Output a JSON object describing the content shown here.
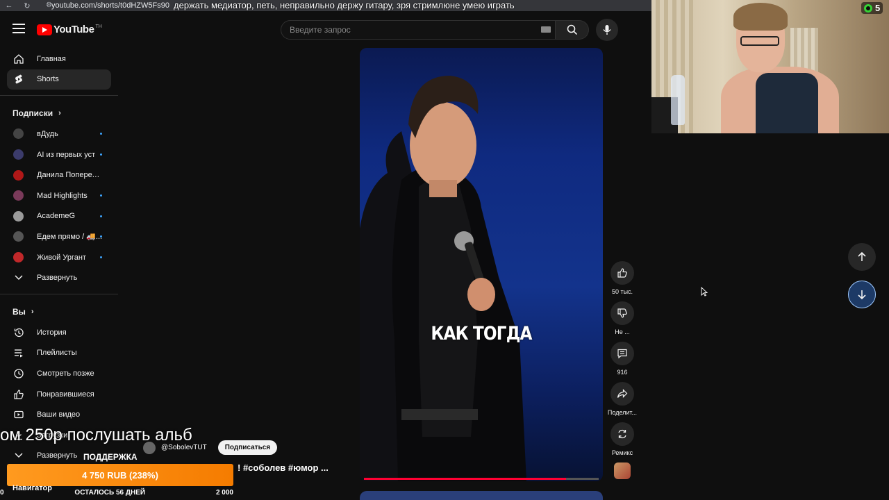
{
  "browser": {
    "url": "youtube.com/shorts/t0dHZW5Fs90"
  },
  "stream_ticker": "держать медиатор, петь, неправильно держу гитару, зря  стримлюне умею играть",
  "header": {
    "logo_text": "YouTube",
    "logo_tm": "TH",
    "search_placeholder": "Введите запрос"
  },
  "sidebar": {
    "main": [
      {
        "label": "Главная",
        "icon": "home-icon"
      },
      {
        "label": "Shorts",
        "icon": "shorts-icon"
      }
    ],
    "subscriptions_title": "Подписки",
    "subscriptions": [
      {
        "label": "вДудь",
        "color": "#444444"
      },
      {
        "label": "AI из первых уст",
        "color": "#3b3b6b"
      },
      {
        "label": "Данила Поперечн...",
        "color": "#b01818"
      },
      {
        "label": "Mad Highlights",
        "color": "#7a3a5a"
      },
      {
        "label": "AcademeG",
        "color": "#9a9a9a"
      },
      {
        "label": "Едем прямо / 🚚...",
        "color": "#555555"
      },
      {
        "label": "Живой Ургант",
        "color": "#c0282a"
      }
    ],
    "expand_label": "Развернуть",
    "you_title": "Вы",
    "you_items": [
      {
        "label": "История",
        "icon": "history-icon"
      },
      {
        "label": "Плейлисты",
        "icon": "playlist-icon"
      },
      {
        "label": "Смотреть позже",
        "icon": "clock-icon"
      },
      {
        "label": "Понравившиеся",
        "icon": "thumb-up-icon"
      },
      {
        "label": "Ваши видео",
        "icon": "video-icon"
      },
      {
        "label": "Загрузки",
        "icon": "download-icon"
      }
    ],
    "expand_label_2": "Развернуть"
  },
  "video": {
    "caption": "КАК ТОГДА",
    "progress": 0.86,
    "channel": "@SobolevTUT",
    "subscribe_label": "Подписаться",
    "title_visible": "! #соболев #юмор ..."
  },
  "actions": {
    "likes": "50 тыс.",
    "dislike": "Не ...",
    "comments": "916",
    "share": "Поделит...",
    "remix": "Ремикс"
  },
  "overlay": {
    "big_text": "ом 250р послушать альб",
    "viewer_count": "5",
    "donation_title": "ПОДДЕРЖКА",
    "donation_amount": "4 750 RUB (238%)",
    "donation_min": "0",
    "donation_days": "ОСТАЛОСЬ 56 ДНЕЙ",
    "donation_goal": "2 000",
    "navigator": "Навигатор"
  },
  "colors": {
    "accent": "#ff0000",
    "progress": "#ff0033",
    "unread_dot": "#3ea6ff",
    "donation": "#f57c00"
  }
}
